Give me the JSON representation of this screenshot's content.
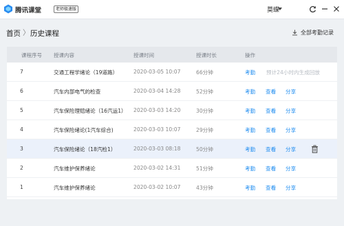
{
  "app": {
    "title": "腾讯课堂",
    "badge": "老师极速版",
    "user": "莫蝶"
  },
  "window": {
    "refresh_icon": "refresh-icon",
    "minimize_icon": "minimize-icon",
    "close_icon": "close-icon"
  },
  "breadcrumb": {
    "home": "首页",
    "separator": "〉",
    "current": "历史课程"
  },
  "records_link": {
    "label": "全部考勤记录",
    "icon": "download-icon"
  },
  "table": {
    "headers": {
      "no": "课程序号",
      "title": "授课内容",
      "time": "授课时间",
      "duration": "授课时长",
      "actions": "操作"
    },
    "rows": [
      {
        "no": "7",
        "title": "交通工程学绪论（19道路）",
        "time": "2020-03-05 10:07",
        "duration": "66分钟",
        "attendance": "考勤",
        "note": "预计24小时内生成回放"
      },
      {
        "no": "6",
        "title": "汽车内部电气的检查",
        "time": "2020-03-04 14:28",
        "duration": "52分钟",
        "attendance": "考勤",
        "view": "查看",
        "share": "分享"
      },
      {
        "no": "5",
        "title": "汽车保险理赔绪论（16汽运1）",
        "time": "2020-03-03 14:20",
        "duration": "30分钟",
        "attendance": "考勤",
        "view": "查看",
        "share": "分享"
      },
      {
        "no": "4",
        "title": "汽车保险绪论(1汽车综合)",
        "time": "2020-03-03 10:07",
        "duration": "29分钟",
        "attendance": "考勤",
        "view": "查看",
        "share": "分享"
      },
      {
        "no": "3",
        "title": "汽车保险绪论（18汽检1）",
        "time": "2020-03-03 08:18",
        "duration": "50分钟",
        "attendance": "考勤",
        "view": "查看",
        "share": "分享",
        "highlighted": true
      },
      {
        "no": "2",
        "title": "汽车维护保养绪论",
        "time": "2020-03-02 14:31",
        "duration": "51分钟",
        "attendance": "考勤",
        "view": "查看",
        "share": "分享"
      },
      {
        "no": "1",
        "title": "汽车维护保养绪论",
        "time": "2020-03-02 10:07",
        "duration": "43分钟",
        "attendance": "考勤",
        "view": "查看",
        "share": "分享"
      }
    ]
  },
  "colors": {
    "accent": "#1e8cf0",
    "header_bg": "#e5e8ec",
    "highlight_row": "#ebf1fb",
    "page_bg": "#eef1f4"
  }
}
